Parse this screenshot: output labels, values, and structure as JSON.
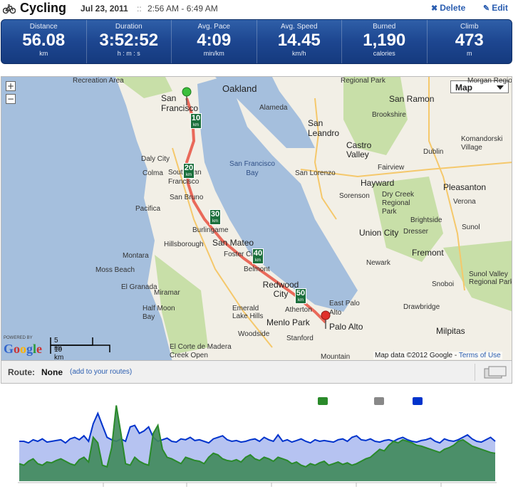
{
  "header": {
    "title": "Cycling",
    "date": "Jul 23, 2011",
    "separator": "::",
    "time_range": "2:56 AM - 6:49 AM",
    "delete_label": "Delete",
    "edit_label": "Edit"
  },
  "stats": [
    {
      "label": "Distance",
      "value": "56.08",
      "unit": "km"
    },
    {
      "label": "Duration",
      "value": "3:52:52",
      "unit": "h : m : s"
    },
    {
      "label": "Avg. Pace",
      "value": "4:09",
      "unit": "min/km"
    },
    {
      "label": "Avg. Speed",
      "value": "14.45",
      "unit": "km/h"
    },
    {
      "label": "Burned",
      "value": "1,190",
      "unit": "calories"
    },
    {
      "label": "Climb",
      "value": "473",
      "unit": "m"
    }
  ],
  "map": {
    "map_type": "Map",
    "zoom_in": "+",
    "zoom_out": "−",
    "labels": {
      "recreation_area": "Recreation Area",
      "oakland": "Oakland",
      "regional_park_top": "Regional Park",
      "san_ramon": "San Ramon",
      "san_francisco": "San Francisco",
      "alameda": "Alameda",
      "brookshire": "Brookshire",
      "san_leandro": "San Leandro",
      "komandorski": "Komandorski Village",
      "dublin": "Dublin",
      "castro_valley": "Castro Valley",
      "daly_city": "Daly City",
      "colma": "Colma",
      "south_sf": "South San Francisco",
      "sf_bay": "San Francisco Bay",
      "san_lorenzo": "San Lorenzo",
      "fairview": "Fairview",
      "pleasanton": "Pleasanton",
      "hayward": "Hayward",
      "san_bruno": "San Bruno",
      "sorenson": "Sorenson",
      "dry_creek": "Dry Creek Regional Park",
      "verona": "Verona",
      "pacifica": "Pacifica",
      "brightside": "Brightside",
      "burlingame": "Burlingame",
      "union_city": "Union City",
      "dresser": "Dresser",
      "sunol": "Sunol",
      "hillsborough": "Hillsborough",
      "san_mateo": "San Mateo",
      "foster_city": "Foster City",
      "fremont": "Fremont",
      "montara": "Montara",
      "belmont": "Belmont",
      "newark": "Newark",
      "moss_beach": "Moss Beach",
      "redwood_city": "Redwood City",
      "sunol_valley": "Sunol Valley Regional Park",
      "el_granada": "El Granada",
      "miramar": "Miramar",
      "emerald_lake": "Emerald Lake Hills",
      "atherton": "Atherton",
      "east_palo_alto": "East Palo Alto",
      "drawbridge": "Drawbridge",
      "half_moon_bay": "Half Moon Bay",
      "menlo_park": "Menlo Park",
      "palo_alto": "Palo Alto",
      "milpitas": "Milpitas",
      "woodside": "Woodside",
      "stanford": "Stanford",
      "snoboi": "Snoboi",
      "el_corte": "El Corte de Madera Creek Open",
      "mountain": "Mountain",
      "morgan_regional": "Morgan Regional"
    },
    "km_markers": [
      "10",
      "20",
      "30",
      "40",
      "50"
    ],
    "km_unit": "km",
    "powered_by": "POWERED BY",
    "google": "Google",
    "scale_mi": "5 mi",
    "scale_km": "10 km",
    "attribution": "Map data ©2012 Google - ",
    "terms": "Terms of Use",
    "colors": {
      "route": "#e85a4a",
      "water": "#a5bfdd",
      "land": "#f2efe6",
      "park": "#c8dfa8",
      "urban": "#e8e4d8"
    }
  },
  "route": {
    "label": "Route:",
    "value": "None",
    "add_link": "(add to your routes)"
  },
  "chart_data": {
    "type": "area",
    "series": [
      {
        "color": "#0033cc",
        "values": [
          50,
          50,
          48,
          52,
          50,
          53,
          49,
          50,
          51,
          52,
          48,
          53,
          55,
          52,
          57,
          50,
          72,
          85,
          70,
          55,
          52,
          50,
          53,
          50,
          68,
          70,
          60,
          63,
          68,
          55,
          50,
          52,
          54,
          50,
          49,
          53,
          52,
          55,
          51,
          52,
          50,
          48,
          53,
          55,
          57,
          52,
          50,
          51,
          49,
          50,
          52,
          53,
          50,
          55,
          52,
          50,
          58,
          50,
          52,
          49,
          51,
          53,
          50,
          48,
          52,
          50,
          51,
          50,
          49,
          52,
          53,
          50,
          55,
          57,
          52,
          51,
          53,
          50,
          49,
          51,
          52,
          50,
          53,
          55,
          52,
          50,
          49,
          51,
          52,
          54,
          50,
          48,
          53,
          51,
          50,
          52,
          55,
          58,
          53,
          50,
          49,
          52,
          55,
          50
        ]
      },
      {
        "color": "#2a8a2a",
        "values": [
          22,
          20,
          25,
          28,
          22,
          20,
          24,
          23,
          26,
          28,
          25,
          22,
          20,
          27,
          30,
          24,
          55,
          48,
          20,
          18,
          42,
          95,
          60,
          22,
          20,
          30,
          25,
          22,
          20,
          60,
          70,
          40,
          30,
          28,
          25,
          22,
          30,
          28,
          26,
          25,
          22,
          30,
          35,
          33,
          28,
          26,
          25,
          27,
          24,
          30,
          33,
          28,
          26,
          30,
          28,
          25,
          30,
          28,
          26,
          22,
          24,
          20,
          18,
          22,
          20,
          23,
          25,
          20,
          22,
          24,
          21,
          23,
          20,
          22,
          25,
          28,
          30,
          35,
          40,
          38,
          45,
          50,
          48,
          52,
          50,
          48,
          45,
          44,
          42,
          40,
          38,
          36,
          40,
          42,
          45,
          50,
          52,
          48,
          44,
          42,
          40,
          38,
          36,
          35
        ]
      }
    ],
    "legend_colors": [
      "#2a8a2a",
      "#888888",
      "#0033cc"
    ]
  }
}
